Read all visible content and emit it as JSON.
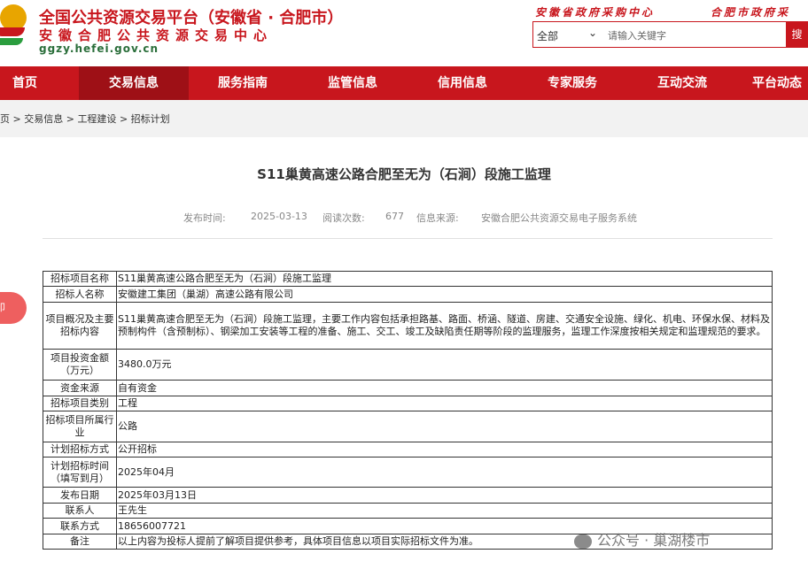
{
  "header": {
    "title_main": "全国公共资源交易平台（安徽省 · 合肥市）",
    "title_sub": "安徽合肥公共资源交易中心",
    "domain": "ggzy.hefei.gov.cn",
    "link_left": "安徽省政府采购中心",
    "link_right": "合肥市政府采",
    "search": {
      "select_value": "全部",
      "placeholder": "请输入关键字",
      "button": "搜"
    }
  },
  "nav": {
    "items": [
      "首页",
      "交易信息",
      "服务指南",
      "监管信息",
      "信用信息",
      "专家服务",
      "互动交流",
      "平台动态"
    ],
    "active_index": 1
  },
  "breadcrumb": {
    "items": [
      "页",
      "交易信息",
      "工程建设",
      "招标计划"
    ],
    "separator": ">"
  },
  "article": {
    "title": "S11巢黄高速公路合肥至无为（石涧）段施工监理",
    "publish_label": "发布时间:",
    "publish_date": "2025-03-13",
    "views_label": "阅读次数:",
    "views": "677",
    "source_label": "信息来源:",
    "source": "安徽合肥公共资源交易电子服务系统"
  },
  "side_tab": "印",
  "table": {
    "rows": [
      {
        "label": "招标项目名称",
        "value": "S11巢黄高速公路合肥至无为（石涧）段施工监理"
      },
      {
        "label": "招标人名称",
        "value": "安徽建工集团（巢湖）高速公路有限公司"
      },
      {
        "label": "项目概况及主要招标内容",
        "value": "S11巢黄高速合肥至无为（石涧）段施工监理，主要工作内容包括承担路基、路面、桥涵、隧道、房建、交通安全设施、绿化、机电、环保水保、材料及预制构件（含预制标）、钢梁加工安装等工程的准备、施工、交工、竣工及缺陷责任期等阶段的监理服务，监理工作深度按相关规定和监理规范的要求。"
      },
      {
        "label": "项目投资金额（万元）",
        "value": "3480.0万元"
      },
      {
        "label": "资金来源",
        "value": "自有资金"
      },
      {
        "label": "招标项目类别",
        "value": "工程"
      },
      {
        "label": "招标项目所属行业",
        "value": "公路"
      },
      {
        "label": "计划招标方式",
        "value": "公开招标"
      },
      {
        "label": "计划招标时间（填写到月）",
        "value": "2025年04月"
      },
      {
        "label": "发布日期",
        "value": "2025年03月13日"
      },
      {
        "label": "联系人",
        "value": "王先生"
      },
      {
        "label": "联系方式",
        "value": "18656007721"
      },
      {
        "label": "备注",
        "value": "以上内容为投标人提前了解项目提供参考，具体项目信息以项目实际招标文件为准。"
      }
    ]
  },
  "watermark": "公众号 · 巢湖楼市",
  "colors": {
    "brand_red": "#c8161d",
    "nav_active": "#9e1016"
  }
}
